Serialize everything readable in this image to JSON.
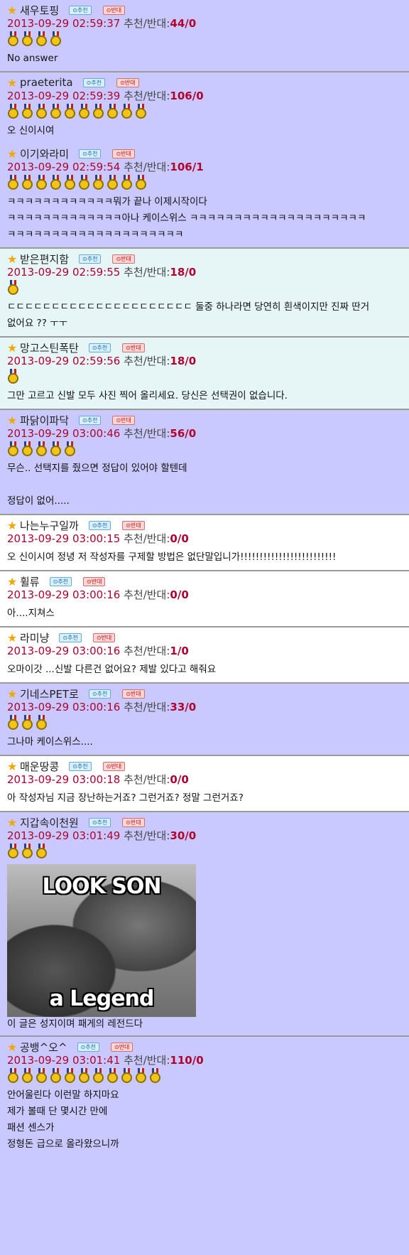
{
  "labels": {
    "recommend": "⊙추천",
    "oppose": "⊙반대",
    "ratio_label": "추천/반대:"
  },
  "colors": {
    "bg_blue": "#c9c9ff",
    "bg_cyan": "#e6f6f6",
    "bg_white": "#ffffff",
    "date_red": "#b00030",
    "star": "#f0a800"
  },
  "comments": [
    {
      "nick": "새우토핑",
      "datetime": "2013-09-29 02:59:37",
      "ratio": "44/0",
      "medals": 4,
      "bg": "blue",
      "lines": [
        "No answer"
      ],
      "image": null
    },
    {
      "nick": "praeterita",
      "datetime": "2013-09-29 02:59:39",
      "ratio": "106/0",
      "medals": 10,
      "bg": "blue",
      "noborder": true,
      "lines": [
        "오 신이시여"
      ],
      "image": null
    },
    {
      "nick": "이기와라미",
      "datetime": "2013-09-29 02:59:54",
      "ratio": "106/1",
      "medals": 10,
      "bg": "blue",
      "lines": [
        "ㅋㅋㅋㅋㅋㅋㅋㅋㅋㅋㅋㅋ뭐가 끝나 이제시작이다",
        "ㅋㅋㅋㅋㅋㅋㅋㅋㅋㅋㅋㅋㅋ아나 케이스위스 ㅋㅋㅋㅋㅋㅋㅋㅋㅋㅋㅋㅋㅋㅋㅋㅋㅋㅋㅋㅋ",
        "ㅋㅋㅋㅋㅋㅋㅋㅋㅋㅋㅋㅋㅋㅋㅋㅋㅋㅋㅋㅋ"
      ],
      "image": null
    },
    {
      "nick": "받은편지함",
      "datetime": "2013-09-29 02:59:55",
      "ratio": "18/0",
      "medals": 1,
      "bg": "cyan",
      "lines": [
        "ㄷㄷㄷㄷㄷㄷㄷㄷㄷㄷㄷㄷㄷㄷㄷㄷㄷㄷㄷㄷㄷ 둘중 하나라면 당연히 흰색이지만 진짜 딴거",
        "없어요 ?? ㅜㅜ"
      ],
      "image": null
    },
    {
      "nick": "망고스틴폭탄",
      "datetime": "2013-09-29 02:59:56",
      "ratio": "18/0",
      "medals": 1,
      "bg": "cyan",
      "lines": [
        "그만 고르고 신발 모두 사진 찍어 올리세요. 당신은 선택권이 없습니다."
      ],
      "image": null
    },
    {
      "nick": "파닭이파닥",
      "datetime": "2013-09-29 03:00:46",
      "ratio": "56/0",
      "medals": 5,
      "bg": "blue",
      "lines": [
        "무슨.. 선택지를 줬으면 정답이 있어야 할텐데",
        "",
        "정답이 없어....."
      ],
      "image": null
    },
    {
      "nick": "나는누구일까",
      "datetime": "2013-09-29 03:00:15",
      "ratio": "0/0",
      "medals": 0,
      "bg": "white",
      "lines": [
        "오 신이시여 정녕 저 작성자를 구제할 방법은 없단말입니가!!!!!!!!!!!!!!!!!!!!!!!!!"
      ],
      "image": null
    },
    {
      "nick": "휠류",
      "datetime": "2013-09-29 03:00:16",
      "ratio": "0/0",
      "medals": 0,
      "bg": "white",
      "lines": [
        "아....지쳐스"
      ],
      "image": null
    },
    {
      "nick": "라미냥",
      "datetime": "2013-09-29 03:00:16",
      "ratio": "1/0",
      "medals": 0,
      "bg": "white",
      "lines": [
        "오마이갓 ...신발 다른건 없어요? 제발 있다고 해줘요"
      ],
      "image": null
    },
    {
      "nick": "기네스PET로",
      "datetime": "2013-09-29 03:00:16",
      "ratio": "33/0",
      "medals": 3,
      "bg": "blue",
      "lines": [
        "그나마 케이스위스...."
      ],
      "image": null
    },
    {
      "nick": "매운땅콩",
      "datetime": "2013-09-29 03:00:18",
      "ratio": "0/0",
      "medals": 0,
      "bg": "white",
      "lines": [
        "아 작성자님 지금 장난하는거죠? 그런거죠? 정말 그런거죠?"
      ],
      "image": null
    },
    {
      "nick": "지갑속이천원",
      "datetime": "2013-09-29 03:01:49",
      "ratio": "30/0",
      "medals": 3,
      "bg": "blue",
      "lines": [
        "이 글은 성지이며 패게의 레전드다"
      ],
      "image": {
        "top": "LOOK SON",
        "bottom": "a Legend"
      }
    },
    {
      "nick": "공뱅^오^",
      "datetime": "2013-09-29 03:01:41",
      "ratio": "110/0",
      "medals": 11,
      "bg": "blue",
      "noborder": true,
      "lines": [
        "안어울린다 이런말 하지마요",
        "제가 볼때 단 몇시간 만에",
        "패션 센스가",
        "정형돈 급으로 올라왔으니까"
      ],
      "image": null
    }
  ]
}
